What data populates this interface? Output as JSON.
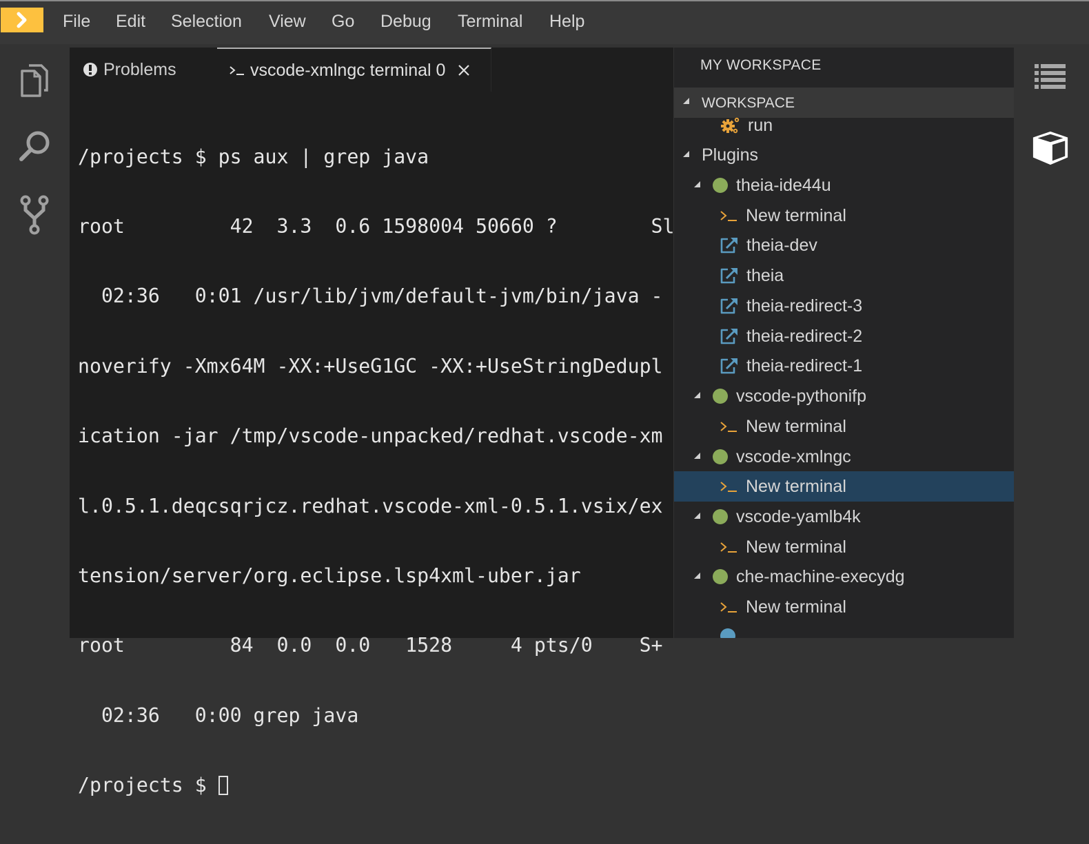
{
  "menubar": {
    "logo_icon": "chevron-right-icon",
    "items": [
      "File",
      "Edit",
      "Selection",
      "View",
      "Go",
      "Debug",
      "Terminal",
      "Help"
    ]
  },
  "activity_bar": {
    "icons": [
      "files-icon",
      "search-icon",
      "source-control-icon"
    ]
  },
  "editor": {
    "tabs": [
      {
        "label": "Problems",
        "icon": "warning-circle-icon",
        "active": false
      },
      {
        "label": "vscode-xmlngc terminal 0",
        "icon": "terminal-icon",
        "active": true,
        "closable": true
      }
    ],
    "terminal": {
      "lines": [
        "/projects $ ps aux | grep java",
        "root         42  3.3  0.6 1598004 50660 ?        Sl",
        "  02:36   0:01 /usr/lib/jvm/default-jvm/bin/java -",
        "noverify -Xmx64M -XX:+UseG1GC -XX:+UseStringDedupl",
        "ication -jar /tmp/vscode-unpacked/redhat.vscode-xm",
        "l.0.5.1.deqcsqrjcz.redhat.vscode-xml-0.5.1.vsix/ex",
        "tension/server/org.eclipse.lsp4xml-uber.jar",
        "root         84  0.0  0.0   1528     4 pts/0    S+",
        "  02:36   0:00 grep java"
      ],
      "prompt": "/projects $ "
    }
  },
  "side_panel": {
    "title": "MY WORKSPACE",
    "section": "WORKSPACE",
    "workspace_items": [
      {
        "label": "run",
        "icon": "gears-icon"
      }
    ],
    "plugins_label": "Plugins",
    "machines": [
      {
        "name": "theia-ide44u",
        "status_color": "#8bab5a",
        "children": [
          {
            "label": "New terminal",
            "icon": "terminal-icon"
          },
          {
            "label": "theia-dev",
            "icon": "external-link-icon"
          },
          {
            "label": "theia",
            "icon": "external-link-icon"
          },
          {
            "label": "theia-redirect-3",
            "icon": "external-link-icon"
          },
          {
            "label": "theia-redirect-2",
            "icon": "external-link-icon"
          },
          {
            "label": "theia-redirect-1",
            "icon": "external-link-icon"
          }
        ]
      },
      {
        "name": "vscode-pythonifp",
        "status_color": "#8bab5a",
        "children": [
          {
            "label": "New terminal",
            "icon": "terminal-icon"
          }
        ]
      },
      {
        "name": "vscode-xmlngc",
        "status_color": "#8bab5a",
        "children": [
          {
            "label": "New terminal",
            "icon": "terminal-icon",
            "selected": true
          }
        ]
      },
      {
        "name": "vscode-yamlb4k",
        "status_color": "#8bab5a",
        "children": [
          {
            "label": "New terminal",
            "icon": "terminal-icon"
          }
        ]
      },
      {
        "name": "che-machine-execydg",
        "status_color": "#8bab5a",
        "children": [
          {
            "label": "New terminal",
            "icon": "terminal-icon"
          }
        ]
      }
    ]
  },
  "right_bar": {
    "icons": [
      "outline-list-icon",
      "workspace-cube-icon"
    ]
  },
  "colors": {
    "accent": "#fdc13f",
    "selection": "#23425c",
    "running": "#8bab5a",
    "terminal_icon": "#e8a33a",
    "link_icon": "#5a9bc0"
  }
}
